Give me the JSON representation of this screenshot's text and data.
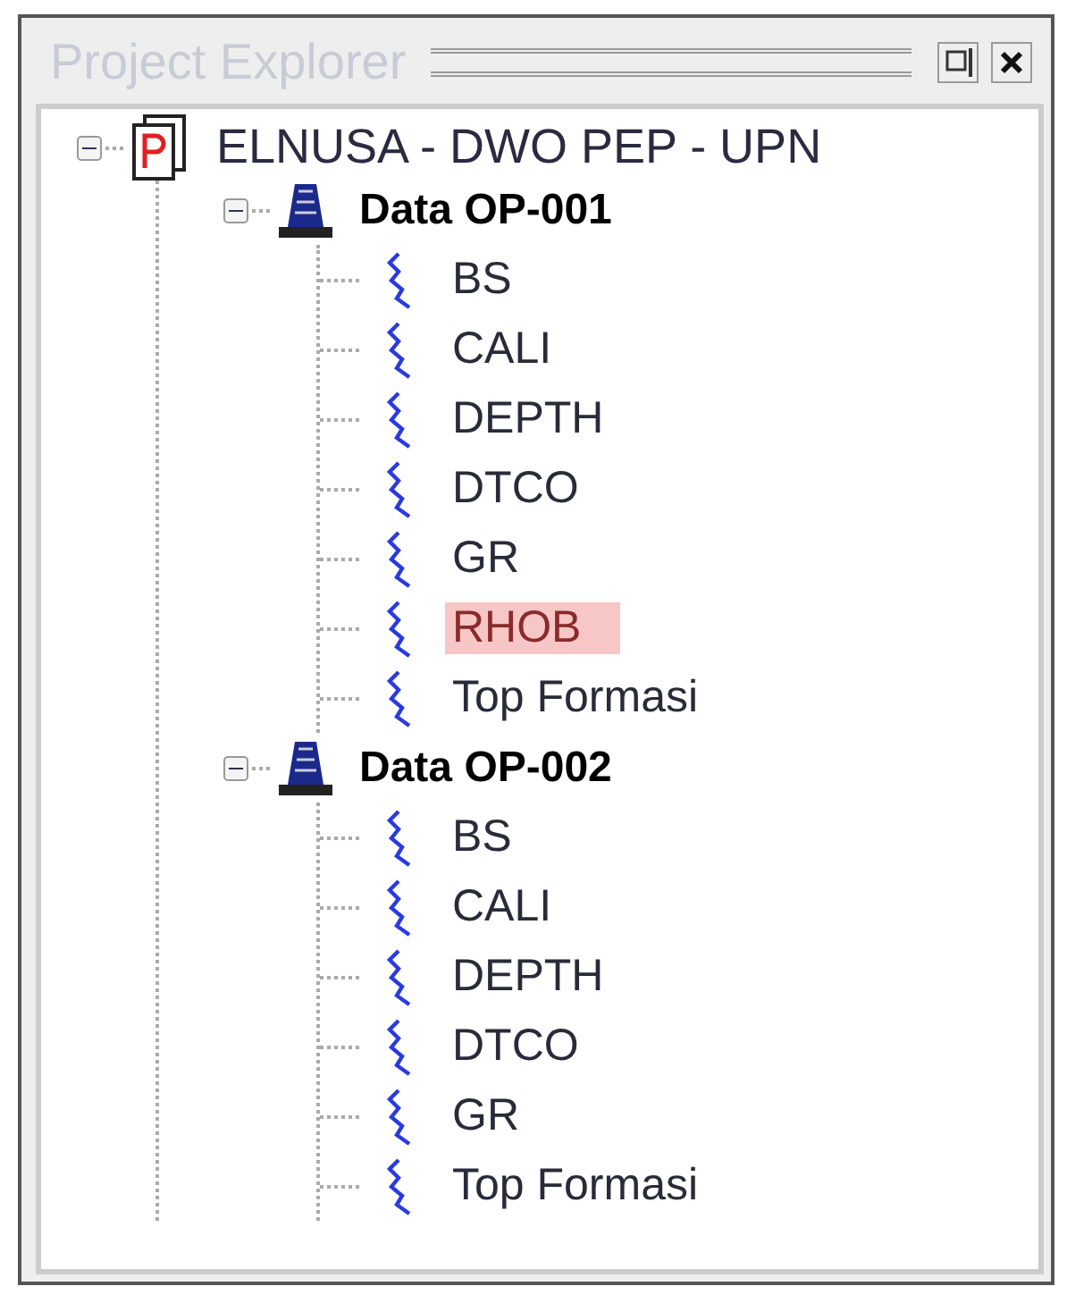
{
  "panel": {
    "title": "Project Explorer"
  },
  "tree": [
    {
      "kind": "project",
      "label": "ELNUSA - DWO PEP - UPN",
      "expanded": true,
      "children": [
        {
          "kind": "well",
          "label": "Data OP-001",
          "expanded": true,
          "children": [
            {
              "kind": "log",
              "label": "BS",
              "selected": false
            },
            {
              "kind": "log",
              "label": "CALI",
              "selected": false
            },
            {
              "kind": "log",
              "label": "DEPTH",
              "selected": false
            },
            {
              "kind": "log",
              "label": "DTCO",
              "selected": false
            },
            {
              "kind": "log",
              "label": "GR",
              "selected": false
            },
            {
              "kind": "log",
              "label": "RHOB",
              "selected": true
            },
            {
              "kind": "log",
              "label": "Top Formasi",
              "selected": false
            }
          ]
        },
        {
          "kind": "well",
          "label": "Data OP-002",
          "expanded": true,
          "children": [
            {
              "kind": "log",
              "label": "BS",
              "selected": false
            },
            {
              "kind": "log",
              "label": "CALI",
              "selected": false
            },
            {
              "kind": "log",
              "label": "DEPTH",
              "selected": false
            },
            {
              "kind": "log",
              "label": "DTCO",
              "selected": false
            },
            {
              "kind": "log",
              "label": "GR",
              "selected": false
            },
            {
              "kind": "log",
              "label": "Top Formasi",
              "selected": false
            }
          ]
        }
      ]
    }
  ]
}
